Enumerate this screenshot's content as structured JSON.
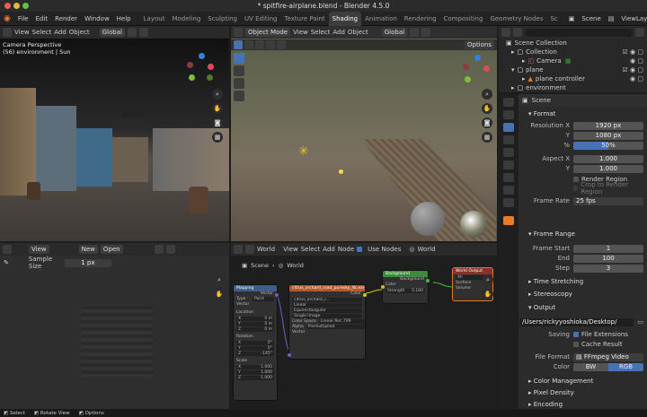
{
  "window": {
    "title": "* spitfire-airplane.blend - Blender 4.5.0"
  },
  "menu": [
    "File",
    "Edit",
    "Render",
    "Window",
    "Help"
  ],
  "workspaces": [
    "Layout",
    "Modeling",
    "Sculpting",
    "UV Editing",
    "Texture Paint",
    "Shading",
    "Animation",
    "Rendering",
    "Compositing",
    "Geometry Nodes",
    "Sc"
  ],
  "scene_selector": "Scene",
  "view_layer": "ViewLayer",
  "camera_view": {
    "header": [
      "View",
      "Select",
      "Add",
      "Object"
    ],
    "orientation": "Global",
    "overlay_title": "Camera Perspective",
    "overlay_sub": "(56) environment | Sun"
  },
  "main_view": {
    "mode": "Object Mode",
    "header": [
      "View",
      "Select",
      "Add",
      "Object"
    ],
    "orientation": "Global",
    "options": "Options"
  },
  "image_editor": {
    "menu": "View",
    "new_label": "New",
    "open_label": "Open",
    "sample_label": "Sample Size",
    "sample_value": "1 px"
  },
  "node_editor": {
    "editor": "World",
    "header": [
      "View",
      "Select",
      "Add",
      "Node"
    ],
    "use_nodes": "Use Nodes",
    "world_name": "World",
    "breadcrumb_scene": "Scene",
    "breadcrumb_world": "World",
    "mapping": {
      "title": "Mapping",
      "out": "Vector",
      "type_label": "Type",
      "type_value": "Point",
      "vector": "Vector",
      "location": "Location",
      "loc": [
        "0 m",
        "0 m",
        "0 m"
      ],
      "rotation": "Rotation",
      "rot": [
        "0°",
        "0°",
        "-145°"
      ],
      "scale": "Scale",
      "scl": [
        "1.000",
        "1.000",
        "1.000"
      ],
      "xyz": [
        "X",
        "Y",
        "Z"
      ],
      "vector_in": "Vector"
    },
    "envtex": {
      "title": "citrus_orchard_road_puresky_4k.exr",
      "color": "Color",
      "file": "citrus_orchard_r...",
      "interp": "Linear",
      "proj": "Equirectangular",
      "src": "Single Image",
      "cs_label": "Color Space",
      "cs_value": "Linear Rec.709",
      "alpha_label": "Alpha",
      "alpha_value": "Premultiplied",
      "vector": "Vector"
    },
    "background": {
      "title": "Background",
      "out": "Background",
      "color": "Color",
      "strength_label": "Strength",
      "strength_value": "5.100"
    },
    "output": {
      "title": "World Output",
      "target": "All",
      "surface": "Surface",
      "volume": "Volume"
    }
  },
  "outliner": {
    "search": "",
    "items": [
      {
        "label": "Scene Collection",
        "level": 0
      },
      {
        "label": "Collection",
        "level": 1
      },
      {
        "label": "Camera",
        "level": 2
      },
      {
        "label": "plane",
        "level": 1
      },
      {
        "label": "plane controller",
        "level": 2
      },
      {
        "label": "environment",
        "level": 1
      }
    ]
  },
  "properties": {
    "context": "Scene",
    "format": {
      "title": "Format",
      "res_x_label": "Resolution X",
      "res_x": "1920 px",
      "res_y_label": "Y",
      "res_y": "1080 px",
      "pct_label": "%",
      "pct": "50%",
      "pct_fill": 0.5,
      "asp_x_label": "Aspect X",
      "asp_x": "1.000",
      "asp_y_label": "Y",
      "asp_y": "1.000",
      "render_region": "Render Region",
      "crop": "Crop to Render Region",
      "fps_label": "Frame Rate",
      "fps": "25 fps"
    },
    "frame_range": {
      "title": "Frame Range",
      "start_label": "Frame Start",
      "start": "1",
      "end_label": "End",
      "end": "100",
      "step_label": "Step",
      "step": "3"
    },
    "time_stretching": "Time Stretching",
    "stereoscopy": "Stereoscopy",
    "output": {
      "title": "Output",
      "path": "/Users/rickyyoshioka/Desktop/",
      "saving_label": "Saving",
      "file_ext": "File Extensions",
      "cache": "Cache Result",
      "ff_label": "File Format",
      "ff": "FFmpeg Video",
      "color_label": "Color",
      "bw": "BW",
      "rgb": "RGB"
    },
    "color_mgmt": "Color Management",
    "pixel_density": "Pixel Density",
    "encoding": "Encoding"
  },
  "status_bar": [
    "Select",
    "Rotate View",
    "Options"
  ],
  "colors": {
    "accent": "#4772b3",
    "orange": "#e77c2b",
    "green": "#3a9e3a",
    "bg": "#1d1d1d"
  }
}
